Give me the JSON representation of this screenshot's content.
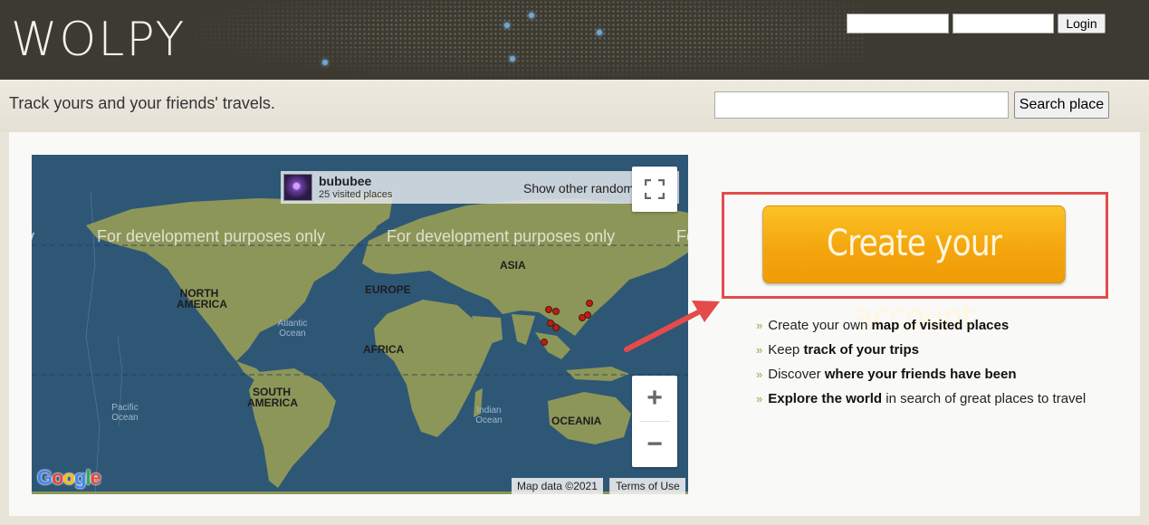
{
  "header": {
    "logo": "WOLPY",
    "login_label": "Login",
    "username_value": "",
    "password_value": ""
  },
  "tagline": "Track yours and your friends' travels.",
  "search": {
    "value": "",
    "button_label": "Search place"
  },
  "map": {
    "user": {
      "name": "bububee",
      "places": "25 visited places"
    },
    "show_other_label": "Show other random user",
    "show_other_icon": "double-chevron-right-icon",
    "dev_text": [
      "ly",
      "For development purposes only",
      "For development purposes only",
      "Fo"
    ],
    "continents": [
      "NORTH AMERICA",
      "EUROPE",
      "ASIA",
      "AFRICA",
      "SOUTH AMERICA",
      "OCEANIA"
    ],
    "oceans": [
      "Atlantic Ocean",
      "Pacific Ocean",
      "Indian Ocean"
    ],
    "zoom_in": "+",
    "zoom_out": "−",
    "google_logo": "Google",
    "map_data": "Map data ©2021",
    "terms": "Terms of Use"
  },
  "cta": {
    "label": "Create your account"
  },
  "features": [
    {
      "pre": "Create your own ",
      "bold": "map of visited places",
      "post": ""
    },
    {
      "pre": "Keep ",
      "bold": "track of your trips",
      "post": ""
    },
    {
      "pre": "Discover ",
      "bold": "where your friends have been",
      "post": ""
    },
    {
      "pre": "",
      "bold": "Explore the world",
      "post": " in search of great places to travel"
    }
  ],
  "colors": {
    "header_bg": "#3c3a31",
    "cta_orange": "#f4a60e",
    "highlight_red": "#e44b4b",
    "ocean": "#2e5776"
  }
}
